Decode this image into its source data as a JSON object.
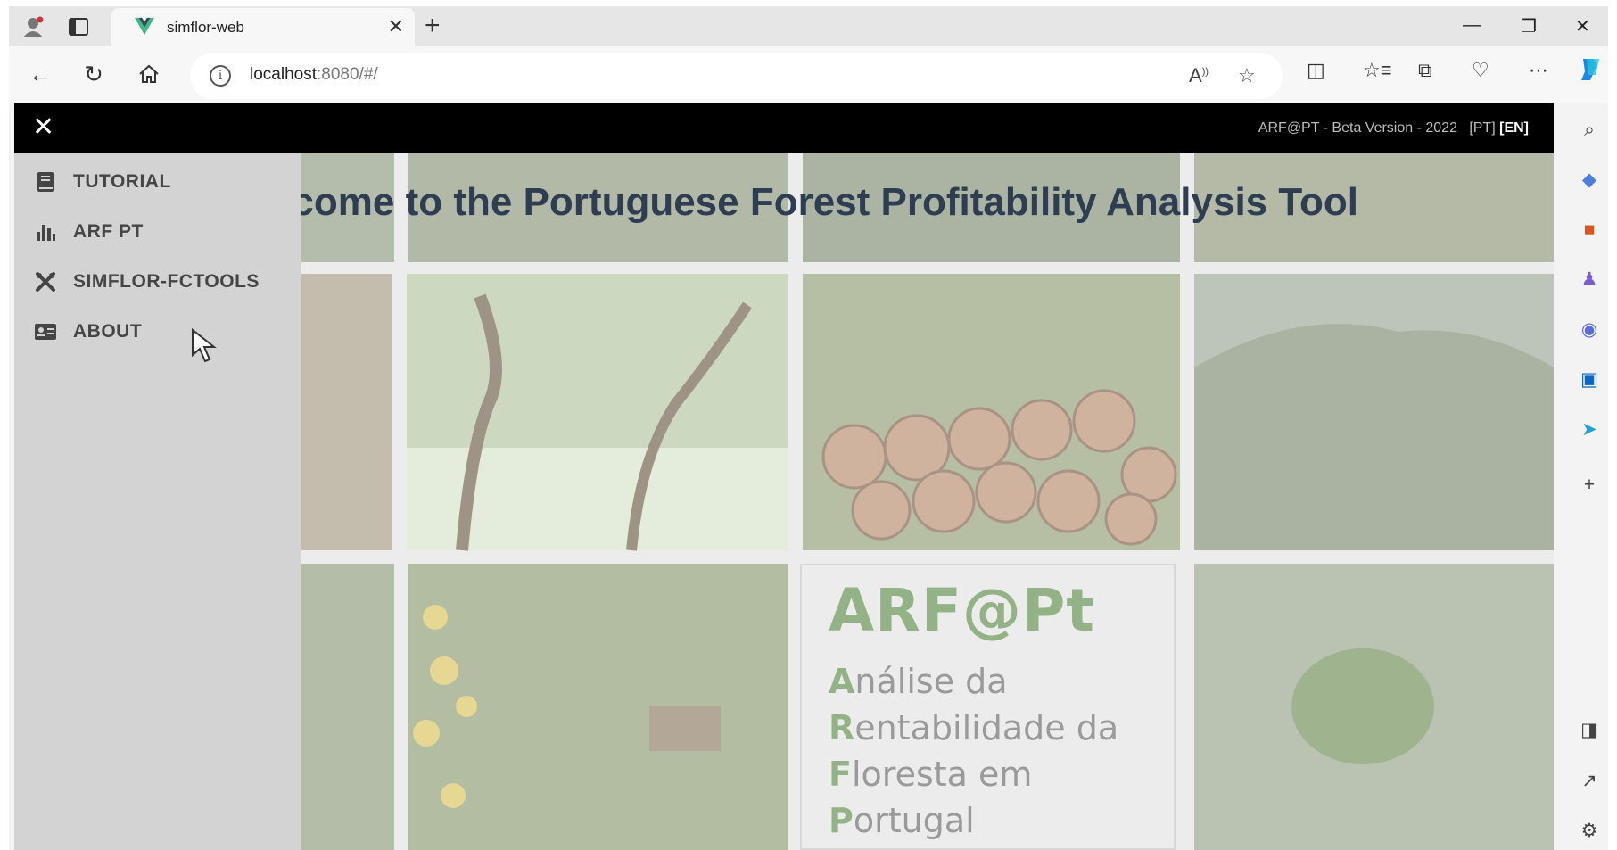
{
  "browser": {
    "tab_title": "simflor-web",
    "address_host": "localhost",
    "address_rest": ":8080/#/"
  },
  "topbar": {
    "close_glyph": "✕",
    "info_text": "ARF@PT - Beta Version - 2022",
    "lang_pt": "[PT]",
    "lang_en": "[EN]"
  },
  "menu": {
    "items": [
      {
        "label": "TUTORIAL",
        "icon": "book-icon"
      },
      {
        "label": "ARF PT",
        "icon": "bar-chart-icon"
      },
      {
        "label": "SIMFLOR-FCTOOLS",
        "icon": "tools-icon"
      },
      {
        "label": "ABOUT",
        "icon": "id-card-icon"
      }
    ]
  },
  "main": {
    "welcome": "Welcome to the Portuguese Forest Profitability Analysis Tool",
    "logo": {
      "title": "ARF@Pt",
      "lines": [
        {
          "cap": "A",
          "rest": "nálise da"
        },
        {
          "cap": "R",
          "rest": "entabilidade da"
        },
        {
          "cap": "F",
          "rest": "loresta em"
        },
        {
          "cap": "P",
          "rest": "ortugal"
        }
      ]
    }
  },
  "colors": {
    "topbar_bg": "#000000",
    "menu_bg": "#d3d3d3",
    "welcome_text": "#2e3d52",
    "logo_green": "#93b386"
  }
}
